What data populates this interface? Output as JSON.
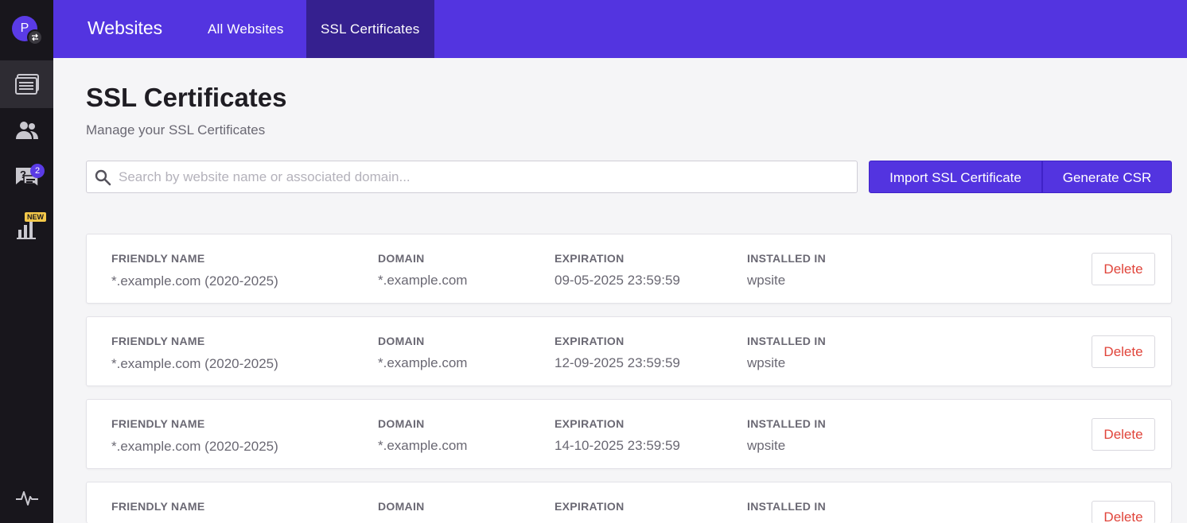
{
  "user": {
    "avatar_initial": "P"
  },
  "sidebar": {
    "items": [
      {
        "icon": "websites-icon",
        "active": true
      },
      {
        "icon": "users-icon",
        "active": false
      },
      {
        "icon": "support-icon",
        "badge": "2"
      },
      {
        "icon": "analytics-icon",
        "badge": "NEW"
      }
    ],
    "bottom_icon": "activity-pulse-icon"
  },
  "topbar": {
    "brand": "Websites",
    "tabs": [
      {
        "label": "All Websites",
        "active": false
      },
      {
        "label": "SSL Certificates",
        "active": true
      }
    ]
  },
  "page": {
    "title": "SSL Certificates",
    "subtitle": "Manage your SSL Certificates"
  },
  "search": {
    "placeholder": "Search by website name or associated domain..."
  },
  "actions": {
    "import_label": "Import SSL Certificate",
    "csr_label": "Generate CSR"
  },
  "columns": {
    "friendly_name": "FRIENDLY NAME",
    "domain": "DOMAIN",
    "expiration": "EXPIRATION",
    "installed_in": "INSTALLED IN"
  },
  "certificates": [
    {
      "friendly_name": "*.example.com (2020-2025)",
      "domain": "*.example.com",
      "expiration": "09-05-2025 23:59:59",
      "installed_in": "wpsite",
      "delete_label": "Delete"
    },
    {
      "friendly_name": "*.example.com (2020-2025)",
      "domain": "*.example.com",
      "expiration": "12-09-2025 23:59:59",
      "installed_in": "wpsite",
      "delete_label": "Delete"
    },
    {
      "friendly_name": "*.example.com (2020-2025)",
      "domain": "*.example.com",
      "expiration": "14-10-2025 23:59:59",
      "installed_in": "wpsite",
      "delete_label": "Delete"
    },
    {
      "friendly_name": "",
      "domain": "",
      "expiration": "",
      "installed_in": "",
      "delete_label": "Delete"
    }
  ],
  "colors": {
    "accent": "#5334e0",
    "sidebar_bg": "#18161c",
    "danger": "#e0443a"
  }
}
